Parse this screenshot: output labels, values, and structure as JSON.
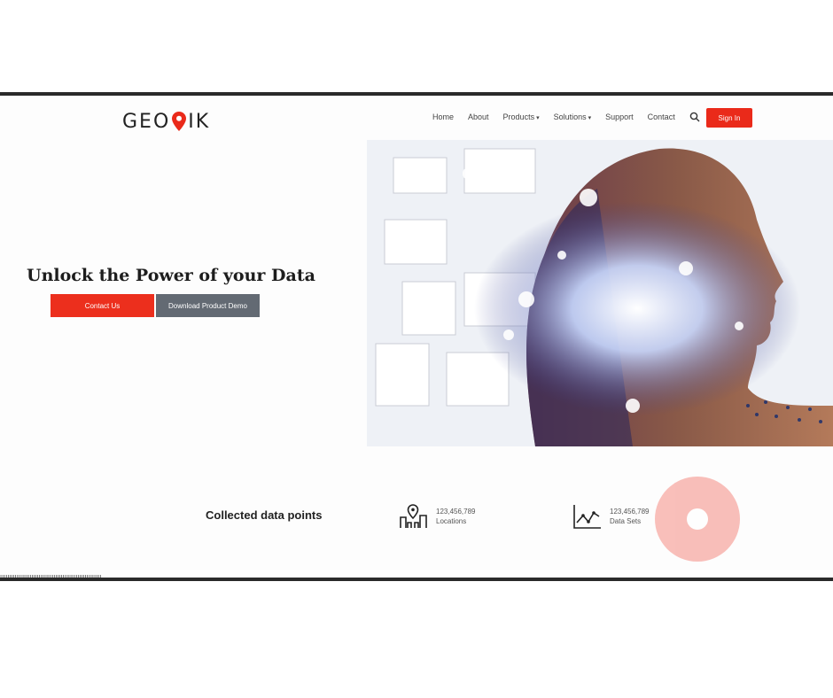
{
  "brand": {
    "logo_left": "GEO",
    "logo_right": "IK",
    "accent": "#ea2a1a"
  },
  "nav": {
    "items": [
      {
        "label": "Home"
      },
      {
        "label": "About"
      },
      {
        "label": "Products",
        "dropdown": true
      },
      {
        "label": "Solutions",
        "dropdown": true
      },
      {
        "label": "Support"
      },
      {
        "label": "Contact"
      }
    ],
    "cta_label": "Sign In"
  },
  "hero": {
    "title": "Unlock the Power of your Data",
    "primary_button": "Contact Us",
    "secondary_button": "Download Product Demo"
  },
  "stats": {
    "title": "Collected data points",
    "items": [
      {
        "icon": "map-pin-buildings-icon",
        "value": "123,456,789",
        "label": "Locations"
      },
      {
        "icon": "chart-icon",
        "value": "123,456,789",
        "label": "Data Sets"
      }
    ]
  },
  "ticker": "|||||||||||||||||||||||||||||||||||||||||||||||||||||||"
}
